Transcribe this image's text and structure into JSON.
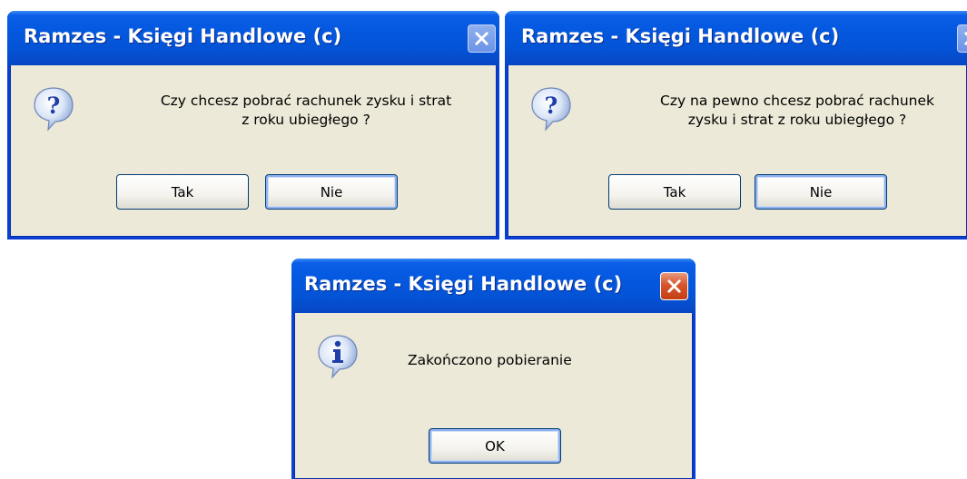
{
  "dialogs": [
    {
      "title": "Ramzes - Księgi Handlowe (c)",
      "icon": "question-icon",
      "message_line1": "Czy chcesz pobrać rachunek zysku i strat",
      "message_line2": "z roku ubiegłego ?",
      "buttons": [
        "Tak",
        "Nie"
      ],
      "close_enabled": false
    },
    {
      "title": "Ramzes - Księgi Handlowe (c)",
      "icon": "question-icon",
      "message_line1": "Czy na pewno chcesz pobrać rachunek",
      "message_line2": "zysku i strat z roku ubiegłego ?",
      "buttons": [
        "Tak",
        "Nie"
      ],
      "close_enabled": false
    },
    {
      "title": "Ramzes - Księgi Handlowe (c)",
      "icon": "info-icon",
      "message_line1": "Zakończono pobieranie",
      "buttons": [
        "OK"
      ],
      "close_enabled": true
    }
  ],
  "colors": {
    "titlebar": "#0453d6",
    "dialog_face": "#ece9d8",
    "close_active": "#d8542a",
    "close_disabled": "#8fb0ef"
  }
}
